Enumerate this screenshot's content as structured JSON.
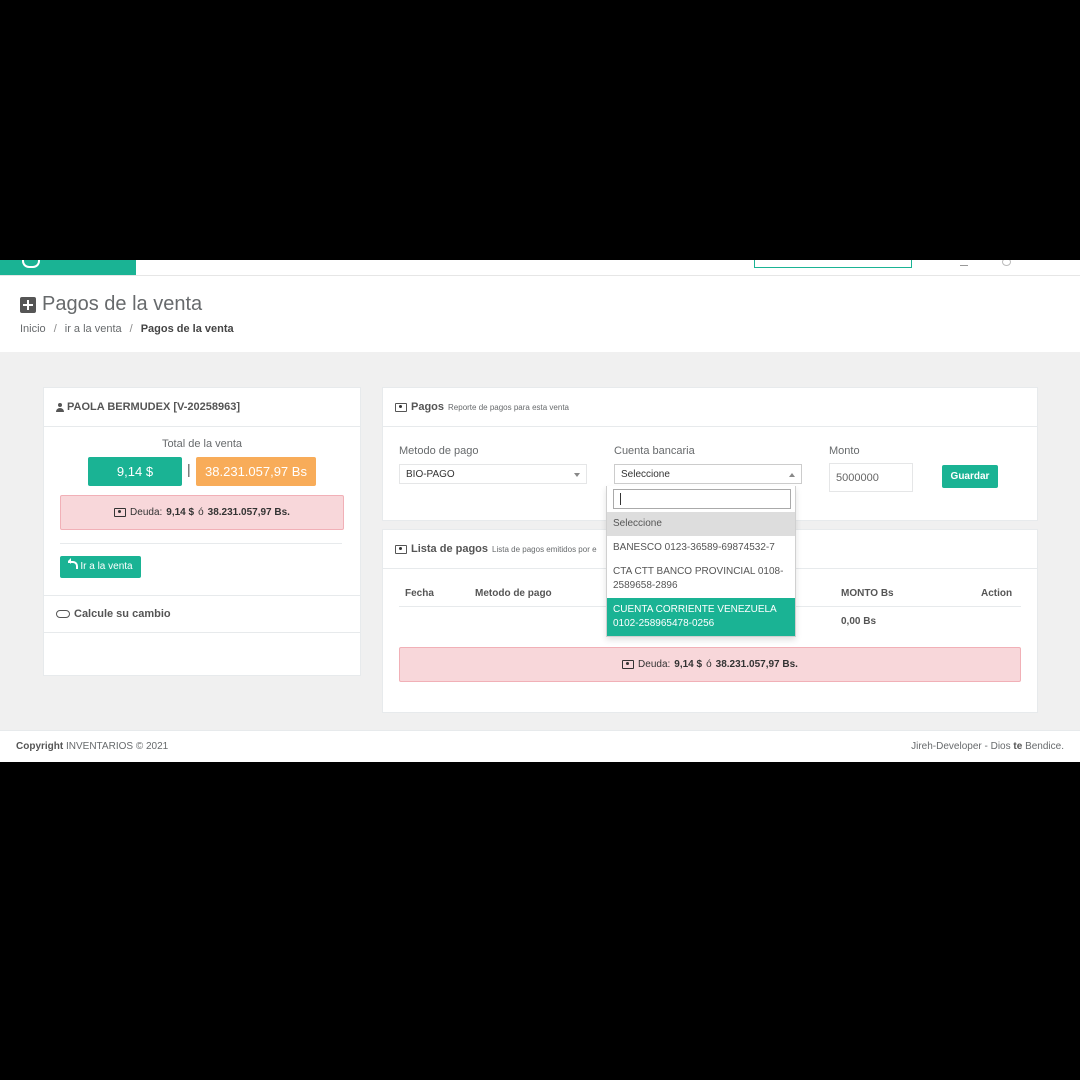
{
  "page": {
    "title": "Pagos de la venta",
    "breadcrumb": [
      "Inicio",
      "ir a la venta",
      "Pagos de la venta"
    ],
    "breadcrumb_sep": "/"
  },
  "customer_card": {
    "name": "PAOLA BERMUDEX [V-20258963]",
    "total_label": "Total de la venta",
    "total_usd": "9,14 $",
    "separator": "|",
    "total_bs": "38.231.057,97 Bs",
    "debt_label": "Deuda:",
    "debt_usd": "9,14 $",
    "debt_or": "ó",
    "debt_bs": "38.231.057,97 Bs.",
    "go_to_sale_button": "Ir a la venta",
    "calc_change_label": "Calcule su cambio"
  },
  "payments_card": {
    "title": "Pagos",
    "subtitle": "Reporte de pagos para esta venta",
    "method_label": "Metodo de pago",
    "method_value": "BIO-PAGO",
    "account_label": "Cuenta bancaria",
    "account_value": "Seleccione",
    "amount_label": "Monto",
    "amount_value": "5000000",
    "save_button": "Guardar"
  },
  "account_dropdown": {
    "options": [
      "Seleccione",
      "BANESCO 0123-36589-69874532-7",
      "CTA CTT BANCO PROVINCIAL 0108-2589658-2896",
      "CUENTA CORRIENTE VENEZUELA 0102-258965478-0256"
    ],
    "selected_index": 0,
    "highlighted_index": 3
  },
  "payments_list": {
    "title": "Lista de pagos",
    "subtitle": "Lista de pagos emitidos por e",
    "columns": [
      "Fecha",
      "Metodo de pago",
      "MONTO Bs",
      "Action"
    ],
    "total_row_amount": "0,00 Bs",
    "debt_label": "Deuda:",
    "debt_usd": "9,14 $",
    "debt_or": "ó",
    "debt_bs": "38.231.057,97 Bs."
  },
  "footer": {
    "copyright_bold": "Copyright",
    "copyright_text": "INVENTARIOS © 2021",
    "credit_pre": "Jireh-Developer - Dios",
    "credit_bold": "te",
    "credit_post": "Bendice."
  },
  "colors": {
    "primary": "#1ab394",
    "warning": "#f8ac59",
    "danger_bg": "#f8d7da"
  }
}
